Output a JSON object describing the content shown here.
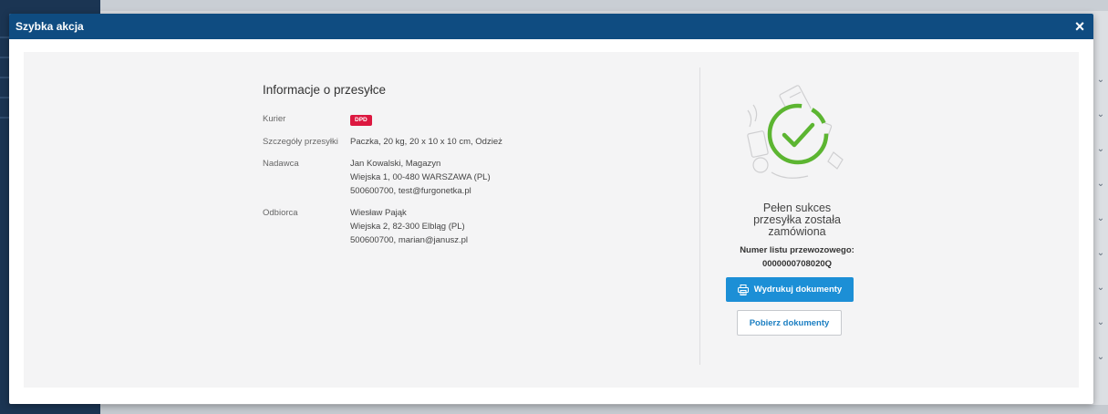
{
  "modal": {
    "title": "Szybka akcja",
    "close_label": "×"
  },
  "shipment": {
    "title": "Informacje o przesyłce",
    "courier_label": "Kurier",
    "courier_badge": "DPD",
    "details_label": "Szczegóły przesyłki",
    "details_value": "Paczka, 20 kg, 20 x 10 x 10 cm, Odzież",
    "sender_label": "Nadawca",
    "sender_lines": [
      "Jan Kowalski, Magazyn",
      "Wiejska 1, 00-480 WARSZAWA (PL)",
      "500600700, test@furgonetka.pl"
    ],
    "recipient_label": "Odbiorca",
    "recipient_lines": [
      "Wiesław Pająk",
      "Wiejska 2, 82-300 Elbląg (PL)",
      "500600700, marian@janusz.pl"
    ]
  },
  "success": {
    "title_lines": [
      "Pełen sukces",
      "przesyłka została",
      "zamówiona"
    ],
    "tracking_label": "Numer listu przewozowego:",
    "tracking_number": "0000000708020Q",
    "print_button": "Wydrukuj dokumenty",
    "download_button": "Pobierz dokumenty"
  },
  "colors": {
    "header": "#0f4c81",
    "courier_badge": "#dc1840",
    "primary_button": "#1c8fd6",
    "success_check": "#5cb531"
  }
}
